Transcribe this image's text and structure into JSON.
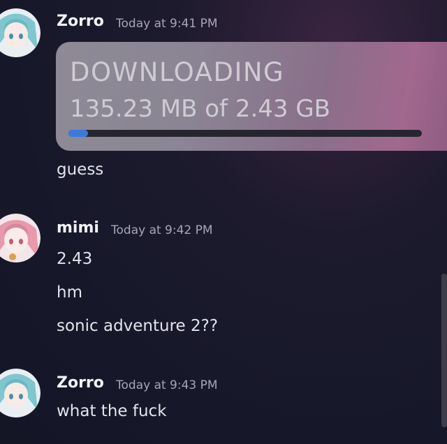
{
  "messages": [
    {
      "username": "Zorro",
      "timestamp": "Today at 9:41 PM",
      "avatar": "teal-anime-avatar",
      "download": {
        "title": "DOWNLOADING",
        "size_text": "135.23 MB of 2.43 GB",
        "progress": 0.055
      },
      "lines": [
        "guess"
      ]
    },
    {
      "username": "mimi",
      "timestamp": "Today at 9:42 PM",
      "avatar": "pink-anime-avatar",
      "lines": [
        "2.43",
        "hm",
        "sonic adventure 2??"
      ]
    },
    {
      "username": "Zorro",
      "timestamp": "Today at 9:43 PM",
      "avatar": "teal-anime-avatar",
      "lines": [
        "what the fuck"
      ]
    }
  ],
  "colors": {
    "progress_fill": "#3b7be0",
    "progress_track": "#26252f",
    "background": "#16182a"
  }
}
